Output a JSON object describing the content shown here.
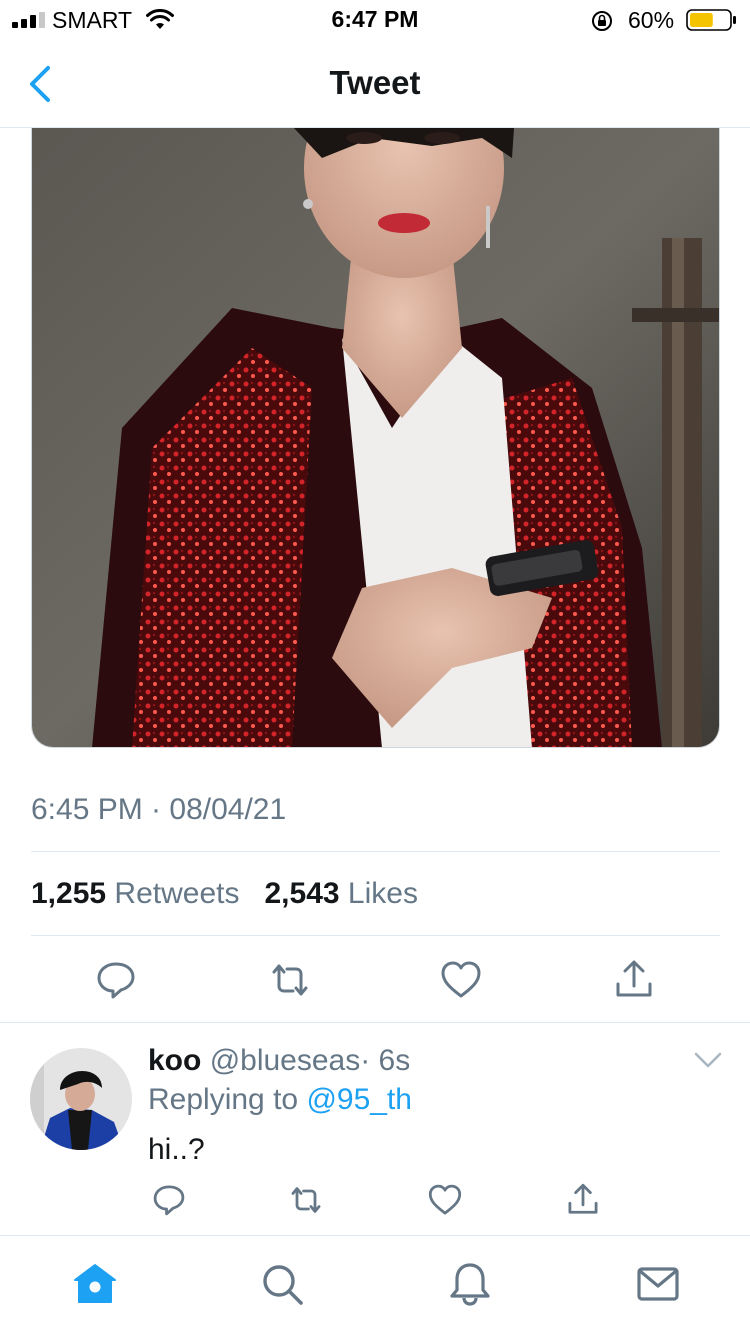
{
  "status_bar": {
    "carrier": "SMART",
    "time": "6:47 PM",
    "battery_percent": "60%",
    "battery_level": 0.6,
    "icons": [
      "signal-icon",
      "wifi-icon",
      "orientation-lock-icon",
      "battery-icon"
    ]
  },
  "nav": {
    "title": "Tweet",
    "back_icon": "chevron-left-icon"
  },
  "tweet": {
    "media_description_icon": "photo",
    "timestamp": "6:45 PM · 08/04/21",
    "retweets_count": "1,255",
    "retweets_label": "Retweets",
    "likes_count": "2,543",
    "likes_label": "Likes",
    "actions": [
      "reply-icon",
      "retweet-icon",
      "like-icon",
      "share-icon"
    ]
  },
  "reply": {
    "name": "koo",
    "handle": "@blueseas",
    "time": "· 6s",
    "replying_prefix": "Replying to",
    "replying_mention": "@95_th",
    "text": "hi..?"
  },
  "tab_bar": {
    "tabs": [
      "home-icon",
      "search-icon",
      "notifications-icon",
      "messages-icon"
    ],
    "active": "home-icon"
  },
  "colors": {
    "accent": "#1da1f2",
    "secondary_text": "#657786",
    "icon": "#657786",
    "battery_fill": "#f5c400"
  }
}
